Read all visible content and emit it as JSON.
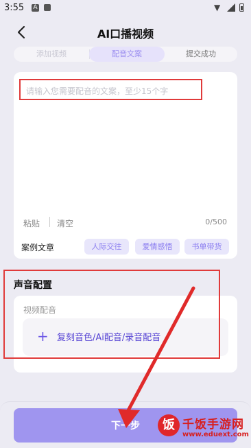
{
  "status_bar": {
    "time": "3:55",
    "a_badge": "A"
  },
  "header": {
    "title": "AI口播视频"
  },
  "steps": [
    "添加视频",
    "配音文案",
    "提交成功"
  ],
  "script_input": {
    "placeholder": "请输入您需要配音的文案，至少15个字",
    "paste_label": "粘贴",
    "clear_label": "清空",
    "counter": "0/500"
  },
  "samples": {
    "label": "案例文章",
    "tags": [
      "人际交往",
      "爱情感悟",
      "书单带货"
    ]
  },
  "voice": {
    "title": "声音配置",
    "subtitle": "视频配音",
    "button_label": "复刻音色/Ai配音/录音配音"
  },
  "footer": {
    "next_label": "下一步"
  },
  "watermark": {
    "logo": "饭",
    "name": "千饭手游网",
    "url": "www.eduext.com"
  },
  "colors": {
    "accent": "#6b57e6",
    "highlight": "#e03a3a",
    "next_button": "#9f95ef"
  }
}
